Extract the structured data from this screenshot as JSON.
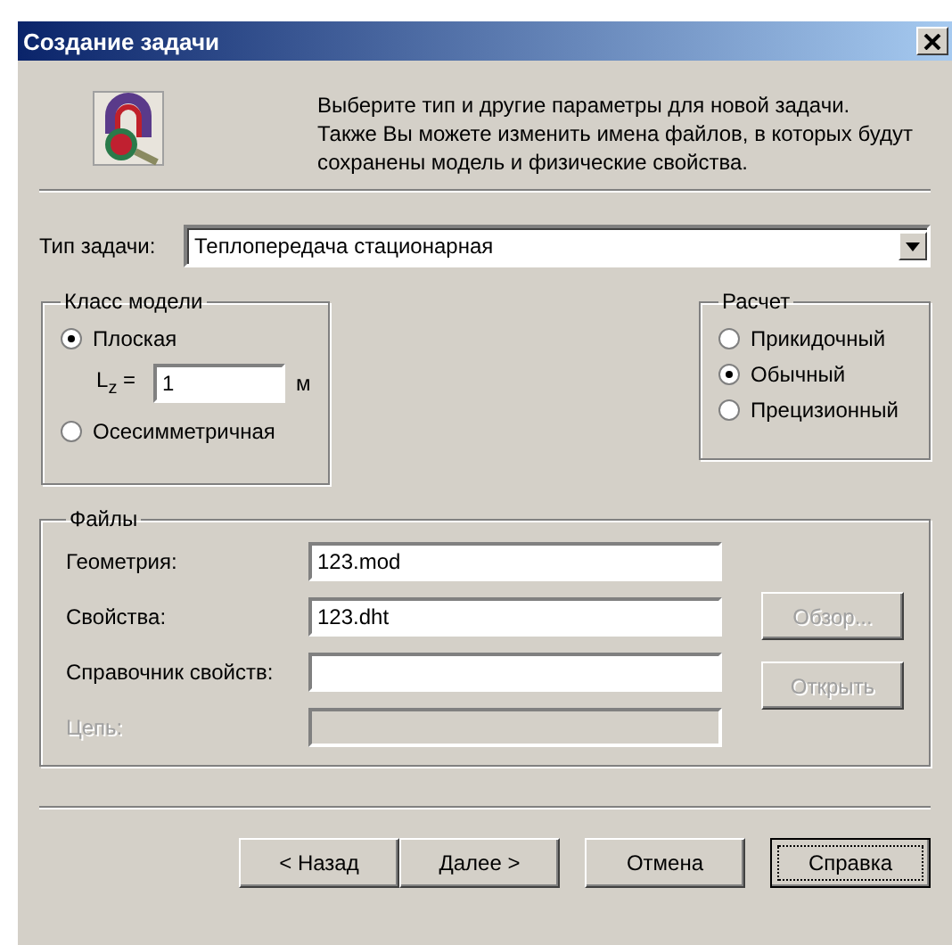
{
  "window": {
    "title": "Создание задачи"
  },
  "intro": [
    "Выберите тип и другие параметры для новой задачи.",
    "Также Вы можете изменить имена файлов, в которых будут",
    "сохранены модель и физические свойства."
  ],
  "task_type": {
    "label": "Тип задачи:",
    "value": "Теплопередача стационарная"
  },
  "model_class": {
    "title": "Класс модели",
    "options": [
      {
        "label": "Плоская",
        "selected": true
      },
      {
        "label": "Осесимметричная",
        "selected": false
      }
    ],
    "length": {
      "label": "L$_{z}$ =",
      "value": "1",
      "unit": "м"
    }
  },
  "calculation": {
    "title": "Расчет",
    "options": [
      {
        "label": "Прикидочный",
        "selected": false
      },
      {
        "label": "Обычный",
        "selected": true
      },
      {
        "label": "Прецизионный",
        "selected": false
      }
    ]
  },
  "files": {
    "title": "Файлы",
    "rows": [
      {
        "label": "Геометрия:",
        "value": "123.mod",
        "disabled": false
      },
      {
        "label": "Свойства:",
        "value": "123.dht",
        "disabled": false
      },
      {
        "label": "Справочник свойств:",
        "disabled": false
      },
      {
        "label": "Цепь:",
        "disabled": true
      }
    ],
    "buttons": [
      {
        "label": "Обзор...",
        "disabled": true
      },
      {
        "label": "Открыть",
        "disabled": true
      }
    ]
  },
  "buttons": [
    {
      "label": "< Назад",
      "focused": false
    },
    {
      "label": "Далее >",
      "focused": false
    },
    {
      "label": "Отмена",
      "focused": false
    },
    {
      "label": "Справка",
      "focused": true
    }
  ]
}
